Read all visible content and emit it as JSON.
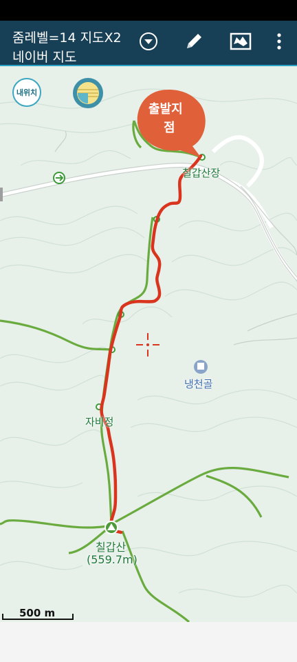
{
  "appbar": {
    "zoom_label": "줌레벨=14 지도X2",
    "map_name": "네이버 지도",
    "icons": [
      "dropdown-icon",
      "pencil-icon",
      "map-layers-icon",
      "more-vert-icon"
    ]
  },
  "map": {
    "my_location_button": "내위치",
    "start_marker_line1": "출발지",
    "start_marker_line2": "점",
    "places": {
      "chilgap_sanjang": "칠갑산장",
      "naengcheongol": "냉천골",
      "jabijeong": "자비정",
      "summit_name": "칠갑산",
      "summit_elevation": "(559.7m)"
    },
    "scale": "500 m",
    "colors": {
      "track": "#d9341e",
      "trail": "#5fa536",
      "marker": "#e0603a",
      "road": "#ffffff"
    }
  }
}
